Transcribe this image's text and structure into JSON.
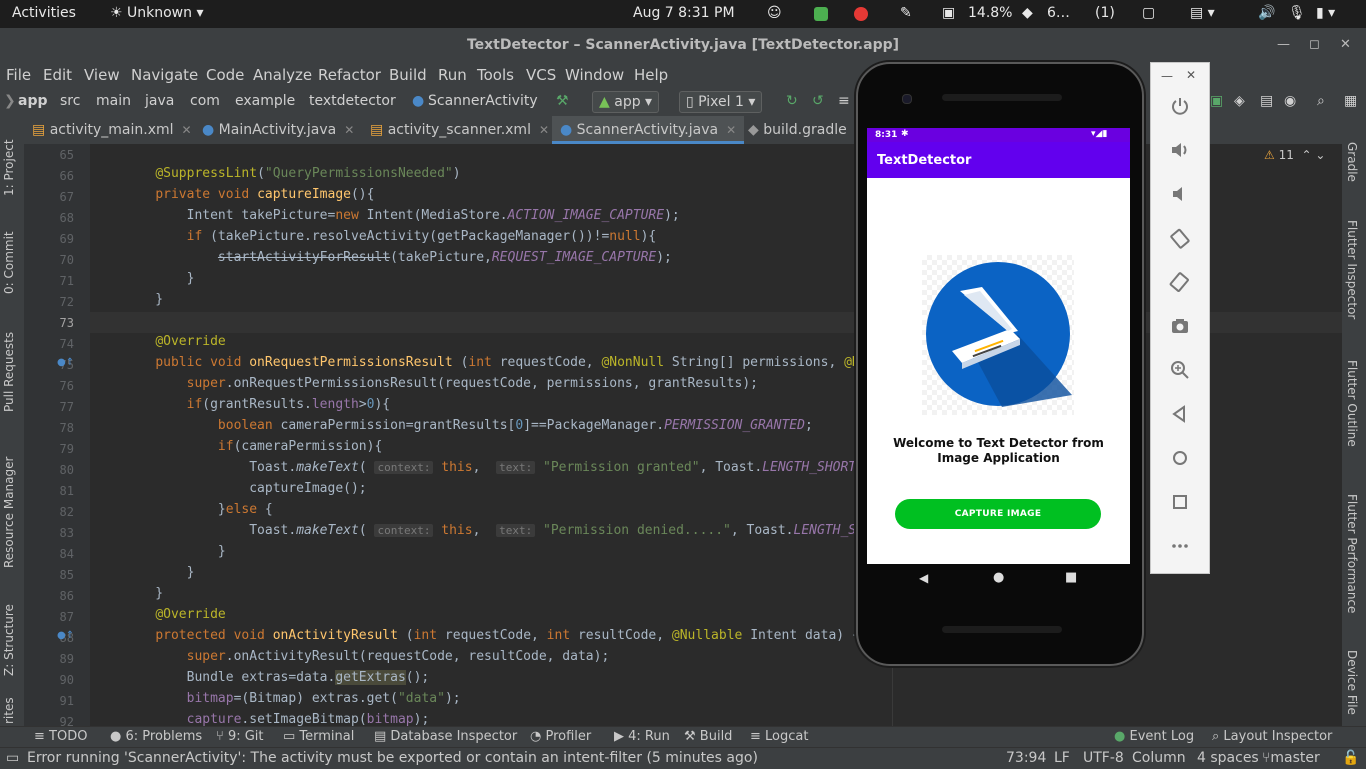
{
  "gnome": {
    "activities": "Activities",
    "app_menu": "Unknown",
    "clock": "Aug 7   8:31 PM",
    "cpu": "14.8%",
    "mem": "6…",
    "notif": "(1)"
  },
  "window": {
    "title": "TextDetector – ScannerActivity.java [TextDetector.app]"
  },
  "menu": [
    "File",
    "Edit",
    "View",
    "Navigate",
    "Code",
    "Analyze",
    "Refactor",
    "Build",
    "Run",
    "Tools",
    "VCS",
    "Window",
    "Help"
  ],
  "breadcrumb": [
    "app",
    "src",
    "main",
    "java",
    "com",
    "example",
    "textdetector",
    "ScannerActivity"
  ],
  "toolbar": {
    "run_config": "app",
    "device": "Pixel 1"
  },
  "tabs": [
    {
      "label": "activity_main.xml"
    },
    {
      "label": "MainActivity.java"
    },
    {
      "label": "activity_scanner.xml"
    },
    {
      "label": "ScannerActivity.java"
    },
    {
      "label": "build.gradle"
    }
  ],
  "left_tools": [
    "1: Project",
    "0: Commit",
    "Pull Requests",
    "Resource Manager",
    "Z: Structure",
    "rites"
  ],
  "right_tools": [
    "Gradle",
    "Flutter Inspector",
    "Flutter Outline",
    "Flutter Performance",
    "Device File"
  ],
  "editor": {
    "warnings": "11",
    "lines": [
      "65",
      "66",
      "67",
      "68",
      "69",
      "70",
      "71",
      "72",
      "73",
      "74",
      "75",
      "76",
      "77",
      "78",
      "79",
      "80",
      "81",
      "82",
      "83",
      "84",
      "85",
      "86",
      "87",
      "88",
      "89",
      "90",
      "91",
      "92"
    ]
  },
  "code": {
    "l66": "\"QueryPermissionsNeeded\"",
    "l80_str": "\"Permission granted\"",
    "l83_str": "\"Permission denied.....\"",
    "l91_str": "\"data\"",
    "hint_context": "context:",
    "hint_text": "text:"
  },
  "bottom_tools": [
    "TODO",
    "6: Problems",
    "9: Git",
    "Terminal",
    "Database Inspector",
    "Profiler",
    "4: Run",
    "Build",
    "Logcat",
    "Event Log",
    "Layout Inspector"
  ],
  "status": {
    "message": "Error running 'ScannerActivity': The activity must be exported or contain an intent-filter (5 minutes ago)",
    "position": "73:94",
    "line_sep": "LF",
    "encoding": "UTF-8",
    "mode": "Column",
    "indent": "4 spaces",
    "branch": "master"
  },
  "phone": {
    "time": "8:31",
    "app_title": "TextDetector",
    "welcome": "Welcome to Text Detector from Image Application",
    "button": "CAPTURE IMAGE"
  }
}
